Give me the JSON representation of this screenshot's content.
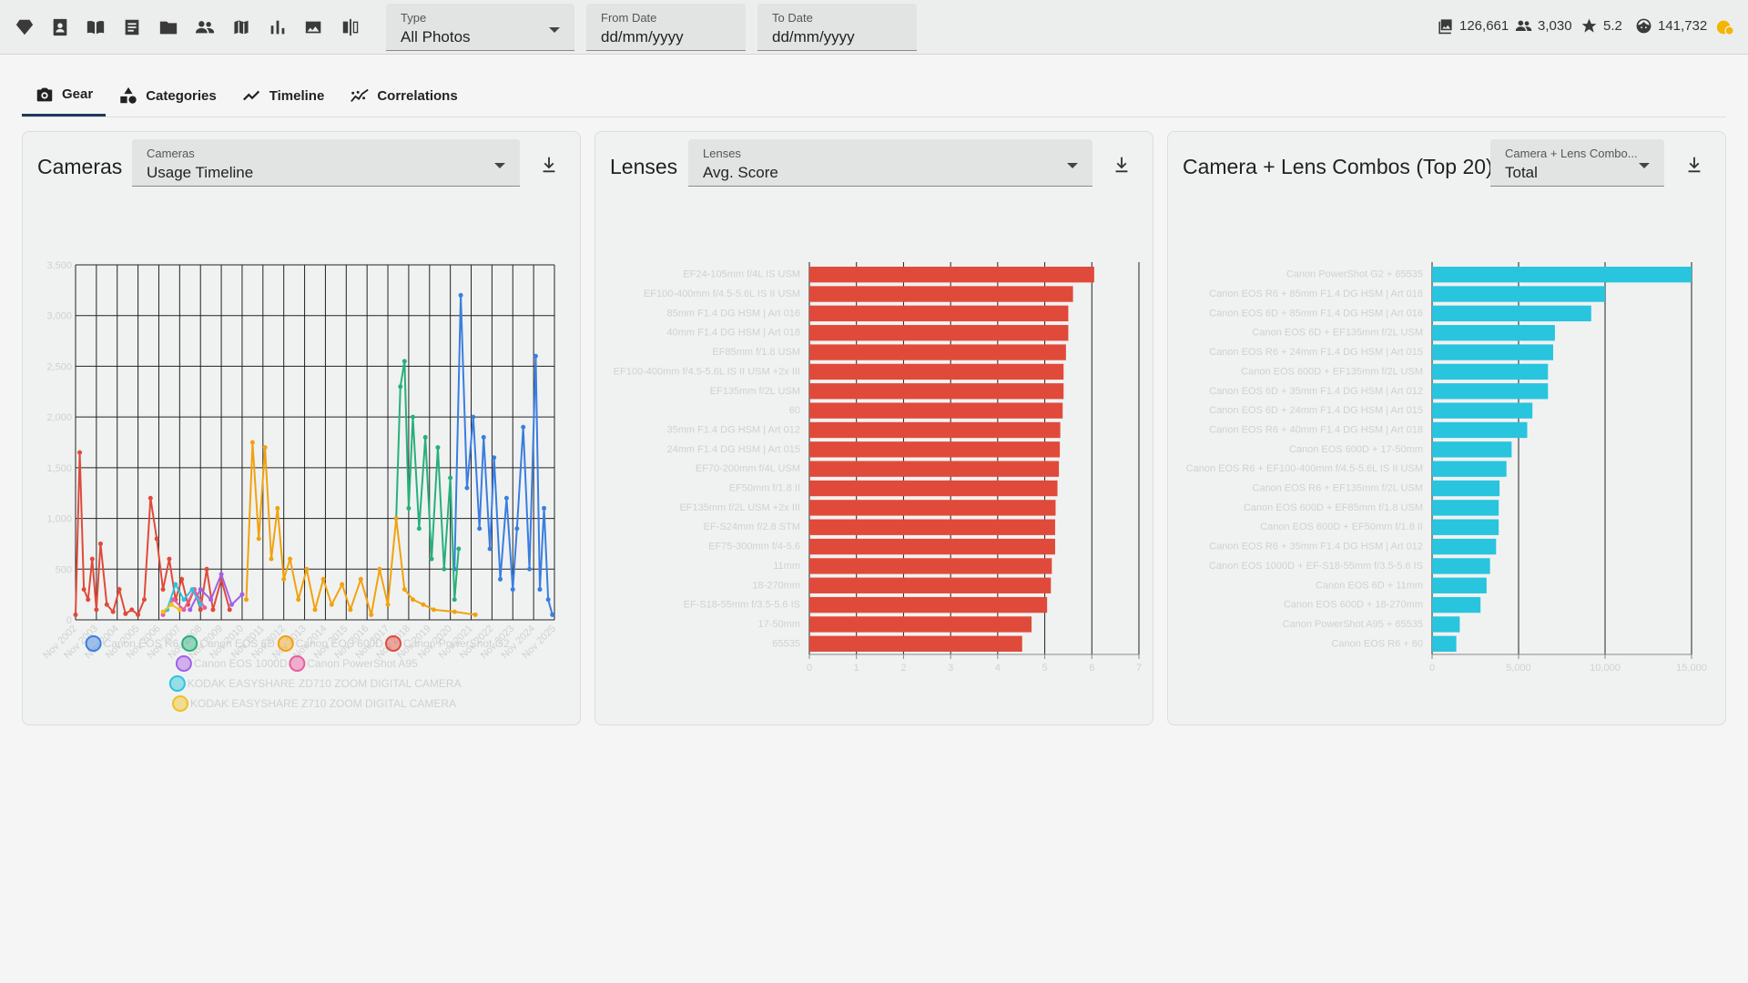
{
  "toolbar": {
    "icons": [
      "gem-icon",
      "contact-book-icon",
      "open-book-icon",
      "document-icon",
      "folder-icon",
      "people-icon",
      "map-icon",
      "bar-chart-icon",
      "photo-library-icon",
      "compare-icon"
    ],
    "type_filter": {
      "label": "Type",
      "value": "All Photos"
    },
    "from_date": {
      "label": "From Date",
      "value": "dd/mm/yyyy"
    },
    "to_date": {
      "label": "To Date",
      "value": "dd/mm/yyyy"
    },
    "stats": {
      "photos": "126,661",
      "people": "3,030",
      "score": "5.2",
      "faces": "141,732"
    }
  },
  "tabs": [
    {
      "label": "Gear",
      "icon": "camera-icon",
      "active": true
    },
    {
      "label": "Categories",
      "icon": "shapes-icon",
      "active": false
    },
    {
      "label": "Timeline",
      "icon": "trend-icon",
      "active": false
    },
    {
      "label": "Correlations",
      "icon": "scatter-trend-icon",
      "active": false
    }
  ],
  "cameras_card": {
    "title": "Cameras",
    "select_label": "Cameras",
    "select_value": "Usage Timeline"
  },
  "lenses_card": {
    "title": "Lenses",
    "select_label": "Lenses",
    "select_value": "Avg. Score"
  },
  "combos_card": {
    "title": "Camera + Lens Combos (Top 20)",
    "select_label": "Camera + Lens Combo...",
    "select_value": "Total"
  },
  "colors": {
    "red": "#e04a3a",
    "green": "#27b07a",
    "orange": "#f1a20f",
    "blue": "#3a7ee0",
    "purple": "#a260e6",
    "pink": "#ea5aa0",
    "cyan": "#29c4de",
    "yellow": "#f0c020"
  },
  "chart_data": [
    {
      "type": "line",
      "title": "Cameras",
      "ylim": [
        0,
        3500
      ],
      "y_ticks": [
        "0",
        "500",
        "1,000",
        "1,500",
        "2,000",
        "2,500",
        "3,000",
        "3,500"
      ],
      "x_ticks": [
        "Nov 2002",
        "Nov 2003",
        "Nov 2004",
        "Nov 2005",
        "Nov 2006",
        "Nov 2007",
        "Nov 2008",
        "Nov 2009",
        "Nov 2010",
        "Nov 2011",
        "Nov 2012",
        "Nov 2013",
        "Nov 2014",
        "Nov 2015",
        "Nov 2016",
        "Nov 2017",
        "Nov 2018",
        "Nov 2019",
        "Nov 2020",
        "Nov 2021",
        "Nov 2022",
        "Nov 2023",
        "Nov 2024",
        "Nov 2025"
      ],
      "legend": "bottom",
      "series": [
        {
          "name": "Canon EOS R6",
          "color": "#3a7ee0",
          "x": [
            2021.0,
            2021.3,
            2021.6,
            2021.9,
            2022.2,
            2022.4,
            2022.7,
            2022.9,
            2023.2,
            2023.5,
            2023.8,
            2024.0,
            2024.3,
            2024.6,
            2024.9,
            2025.1,
            2025.3,
            2025.5,
            2025.7
          ],
          "y": [
            500,
            3200,
            1300,
            2000,
            900,
            1800,
            700,
            1600,
            400,
            1200,
            300,
            900,
            1900,
            500,
            2600,
            300,
            1100,
            200,
            50
          ]
        },
        {
          "name": "Canon EOS 6D",
          "color": "#27b07a",
          "x": [
            2018.2,
            2018.4,
            2018.6,
            2018.8,
            2019.0,
            2019.3,
            2019.6,
            2019.9,
            2020.2,
            2020.5,
            2020.8,
            2021.0,
            2021.2
          ],
          "y": [
            1000,
            2300,
            2550,
            1100,
            2000,
            900,
            1800,
            600,
            1700,
            500,
            1400,
            200,
            700
          ]
        },
        {
          "name": "Canon EOS 600D",
          "color": "#f1a20f",
          "x": [
            2011.0,
            2011.3,
            2011.6,
            2011.9,
            2012.2,
            2012.5,
            2012.8,
            2013.1,
            2013.5,
            2013.9,
            2014.3,
            2014.7,
            2015.1,
            2015.6,
            2016.0,
            2016.5,
            2017.0,
            2017.4,
            2017.8,
            2018.2,
            2018.6,
            2019.0,
            2019.5,
            2020.0,
            2021.0,
            2022.0
          ],
          "y": [
            200,
            1750,
            800,
            1700,
            600,
            1100,
            400,
            600,
            200,
            500,
            100,
            400,
            150,
            350,
            100,
            400,
            50,
            500,
            150,
            1000,
            300,
            200,
            150,
            100,
            80,
            50
          ]
        },
        {
          "name": "Canon PowerShot G2",
          "color": "#e04a3a",
          "x": [
            2002.8,
            2003.0,
            2003.2,
            2003.4,
            2003.6,
            2003.8,
            2004.0,
            2004.3,
            2004.6,
            2004.9,
            2005.2,
            2005.5,
            2005.8,
            2006.1,
            2006.4,
            2006.7,
            2007.0,
            2007.3,
            2007.6,
            2007.9,
            2008.2,
            2008.5,
            2008.8,
            2009.1,
            2009.4,
            2009.8,
            2010.2
          ],
          "y": [
            50,
            1650,
            300,
            200,
            600,
            100,
            750,
            150,
            80,
            300,
            60,
            100,
            50,
            200,
            1200,
            800,
            300,
            600,
            200,
            400,
            150,
            300,
            100,
            500,
            100,
            400,
            100
          ]
        },
        {
          "name": "Canon EOS 1000D",
          "color": "#a260e6",
          "x": [
            2008.3,
            2008.8,
            2009.3,
            2009.8,
            2010.3,
            2010.8
          ],
          "y": [
            100,
            300,
            200,
            450,
            150,
            250
          ]
        },
        {
          "name": "Canon PowerShot A95",
          "color": "#ea5aa0",
          "x": [
            2007.0,
            2007.5,
            2008.0,
            2008.5,
            2009.0
          ],
          "y": [
            50,
            200,
            100,
            300,
            120
          ]
        },
        {
          "name": "KODAK EASYSHARE ZD710 ZOOM DIGITAL CAMERA",
          "color": "#29c4de",
          "x": [
            2007.2,
            2007.6,
            2008.0,
            2008.4,
            2008.8
          ],
          "y": [
            100,
            350,
            200,
            300,
            150
          ]
        },
        {
          "name": "KODAK EASYSHARE Z710 ZOOM DIGITAL CAMERA",
          "color": "#f0c020",
          "x": [
            2007.0,
            2007.4,
            2007.8
          ],
          "y": [
            80,
            150,
            100
          ]
        }
      ]
    },
    {
      "type": "bar",
      "orientation": "horizontal",
      "title": "Lenses",
      "color": "#e04a3a",
      "xlim": [
        0,
        7
      ],
      "x_ticks": [
        "0",
        "1",
        "2",
        "3",
        "4",
        "5",
        "6",
        "7"
      ],
      "categories": [
        "EF24-105mm f/4L IS USM",
        "EF100-400mm f/4.5-5.6L IS II USM",
        "85mm F1.4 DG HSM | Art 016",
        "40mm F1.4 DG HSM | Art 018",
        "EF85mm f/1.8 USM",
        "EF100-400mm f/4.5-5.6L IS II USM +2x III",
        "EF135mm f/2L USM",
        "60",
        "35mm F1.4 DG HSM | Art 012",
        "24mm F1.4 DG HSM | Art 015",
        "EF70-200mm f/4L USM",
        "EF50mm f/1.8 II",
        "EF135mm f/2L USM +2x III",
        "EF-S24mm f/2.8 STM",
        "EF75-300mm f/4-5.6",
        "11mm",
        "18-270mm",
        "EF-S18-55mm f/3.5-5.6 IS",
        "17-50mm",
        "65535"
      ],
      "values": [
        6.05,
        5.6,
        5.5,
        5.5,
        5.45,
        5.4,
        5.4,
        5.38,
        5.33,
        5.32,
        5.3,
        5.27,
        5.23,
        5.22,
        5.22,
        5.15,
        5.13,
        5.05,
        4.72,
        4.52
      ]
    },
    {
      "type": "bar",
      "orientation": "horizontal",
      "title": "Camera + Lens Combos (Top 20)",
      "color": "#29c4de",
      "xlim": [
        0,
        15000
      ],
      "x_ticks": [
        "0",
        "5,000",
        "10,000",
        "15,000"
      ],
      "categories": [
        "Canon PowerShot G2 + 65535",
        "Canon EOS R6 + 85mm F1.4 DG HSM | Art 016",
        "Canon EOS 6D + 85mm F1.4 DG HSM | Art 016",
        "Canon EOS 6D + EF135mm f/2L USM",
        "Canon EOS R6 + 24mm F1.4 DG HSM | Art 015",
        "Canon EOS 600D + EF135mm f/2L USM",
        "Canon EOS 6D + 35mm F1.4 DG HSM | Art 012",
        "Canon EOS 6D + 24mm F1.4 DG HSM | Art 015",
        "Canon EOS R6 + 40mm F1.4 DG HSM | Art 018",
        "Canon EOS 600D + 17-50mm",
        "Canon EOS R6 + EF100-400mm f/4.5-5.6L IS II USM",
        "Canon EOS R6 + EF135mm f/2L USM",
        "Canon EOS 600D + EF85mm f/1.8 USM",
        "Canon EOS 600D + EF50mm f/1.8 II",
        "Canon EOS R6 + 35mm F1.4 DG HSM | Art 012",
        "Canon EOS 1000D + EF-S18-55mm f/3.5-5.6 IS",
        "Canon EOS 6D + 11mm",
        "Canon EOS 600D + 18-270mm",
        "Canon PowerShot A95 + 65535",
        "Canon EOS R6 + 60"
      ],
      "values": [
        15000,
        10000,
        9200,
        7100,
        7000,
        6700,
        6700,
        5800,
        5500,
        4600,
        4300,
        3900,
        3850,
        3850,
        3700,
        3350,
        3150,
        2800,
        1600,
        1400
      ]
    }
  ]
}
